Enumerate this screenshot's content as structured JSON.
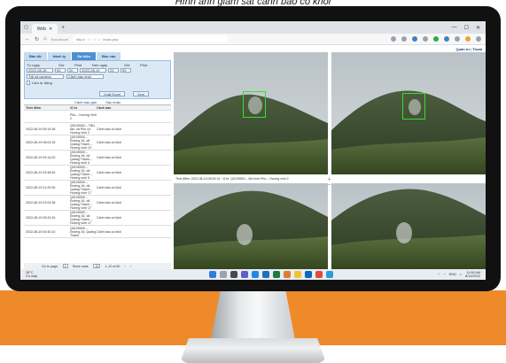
{
  "banner": {
    "title": "Hình ảnh giám sát cảnh báo có khói"
  },
  "browser": {
    "tab_title": "Web",
    "tab_add": "+",
    "address": "Not secure",
    "win_min": "—",
    "win_max": "☐",
    "win_close": "✕",
    "url_text": "http://  ·  /  ·  ·  /  ·  /  ·  /main.php"
  },
  "app": {
    "user": "Quản trị",
    "logout": "Thoát",
    "nav": [
      {
        "label": "Bản đồ"
      },
      {
        "label": "Hành ty"
      },
      {
        "label": "Sự kiện"
      },
      {
        "label": "Báo cáo"
      }
    ],
    "filter": {
      "from_label": "Từ ngày",
      "hour_label": "Giờ",
      "minute_label": "Phút",
      "to_label": "Đến ngày",
      "from_date": "2022-08-18",
      "from_hour": "00",
      "from_minute": "00",
      "to_date": "2022-08-19",
      "to_hour": "23",
      "to_minute": "59",
      "camera_select": "Tất cả camera",
      "warning_select": "Cảnh báo khói",
      "auto_refresh": "Làm tự động",
      "export_button": "Xuất Excel",
      "view_button": "Xem"
    },
    "list_actions": {
      "warning": "Cảnh báo gần",
      "ack": "Xác nhận"
    },
    "table": {
      "headers": [
        "Thời điểm",
        "Vị trí",
        "Cảnh báo"
      ],
      "rows": [
        {
          "time": "",
          "location": "Phú – Hương Vinh 2",
          "warning": ""
        },
        {
          "time": "2022-08-19 05:14:36",
          "location": "Q0109000 – Tiểu tân, xã Phú cư Hương vinh 2",
          "warning": "Cảnh báo có khói"
        },
        {
          "time": "2022-08-19 05:02:15",
          "location": "Q0109000 – Đường 16, xã Quảng Thành – Hương vinh 13",
          "warning": "Cảnh báo có khói"
        },
        {
          "time": "2022-08-19 04:14:20",
          "location": "Q0109000 – Đường 16, xã Quảng Thành – Hương vinh 3",
          "warning": "Cảnh báo có khói"
        },
        {
          "time": "2022-08-19 03:36:40",
          "location": "Q0109000 – Đường 16, xã Quảng Thành – Hương vinh 5",
          "warning": "Cảnh báo có khói"
        },
        {
          "time": "2022-08-19 01:20:30",
          "location": "Q0109000 – Đường 16, xã Quảng Thành – Hương vinh 17",
          "warning": "Cảnh báo có khói"
        },
        {
          "time": "2022-08-19 01:04:38",
          "location": "Q0109000 – Đường 16, xã Quảng Thành – Hương vinh 17",
          "warning": "Cảnh báo có khói"
        },
        {
          "time": "2022-08-19 00:20:16",
          "location": "Q0109000 – Đường 16, xã Quảng Thành – Hương vinh 17",
          "warning": "Cảnh báo có khói"
        },
        {
          "time": "2022-08-19 00:40:10",
          "location": "Q0109000 – Đường 16, Quảng Thành",
          "warning": "Cảnh báo có khói"
        }
      ]
    },
    "pager": {
      "goto_label": "Go to page:",
      "page": "1",
      "rows_label": "Show rows:",
      "rows": "10",
      "range": "1–10 of 80"
    },
    "caption": "Thời điểm: 2022-08-19 05:05:19 ; Vị trí: Q0109000 – Mô hình Phú – Hương vinh 2"
  },
  "taskbar": {
    "weather_temp": "28°C",
    "weather_text": "Có mây",
    "tray_lang": "ENG",
    "clock_time": "11:06 AM",
    "clock_date": "8/19/2022"
  },
  "colors": {
    "accent": "#4e8fd1",
    "detection": "#3ddc2e",
    "brand_orange": "#ef8a2b"
  }
}
